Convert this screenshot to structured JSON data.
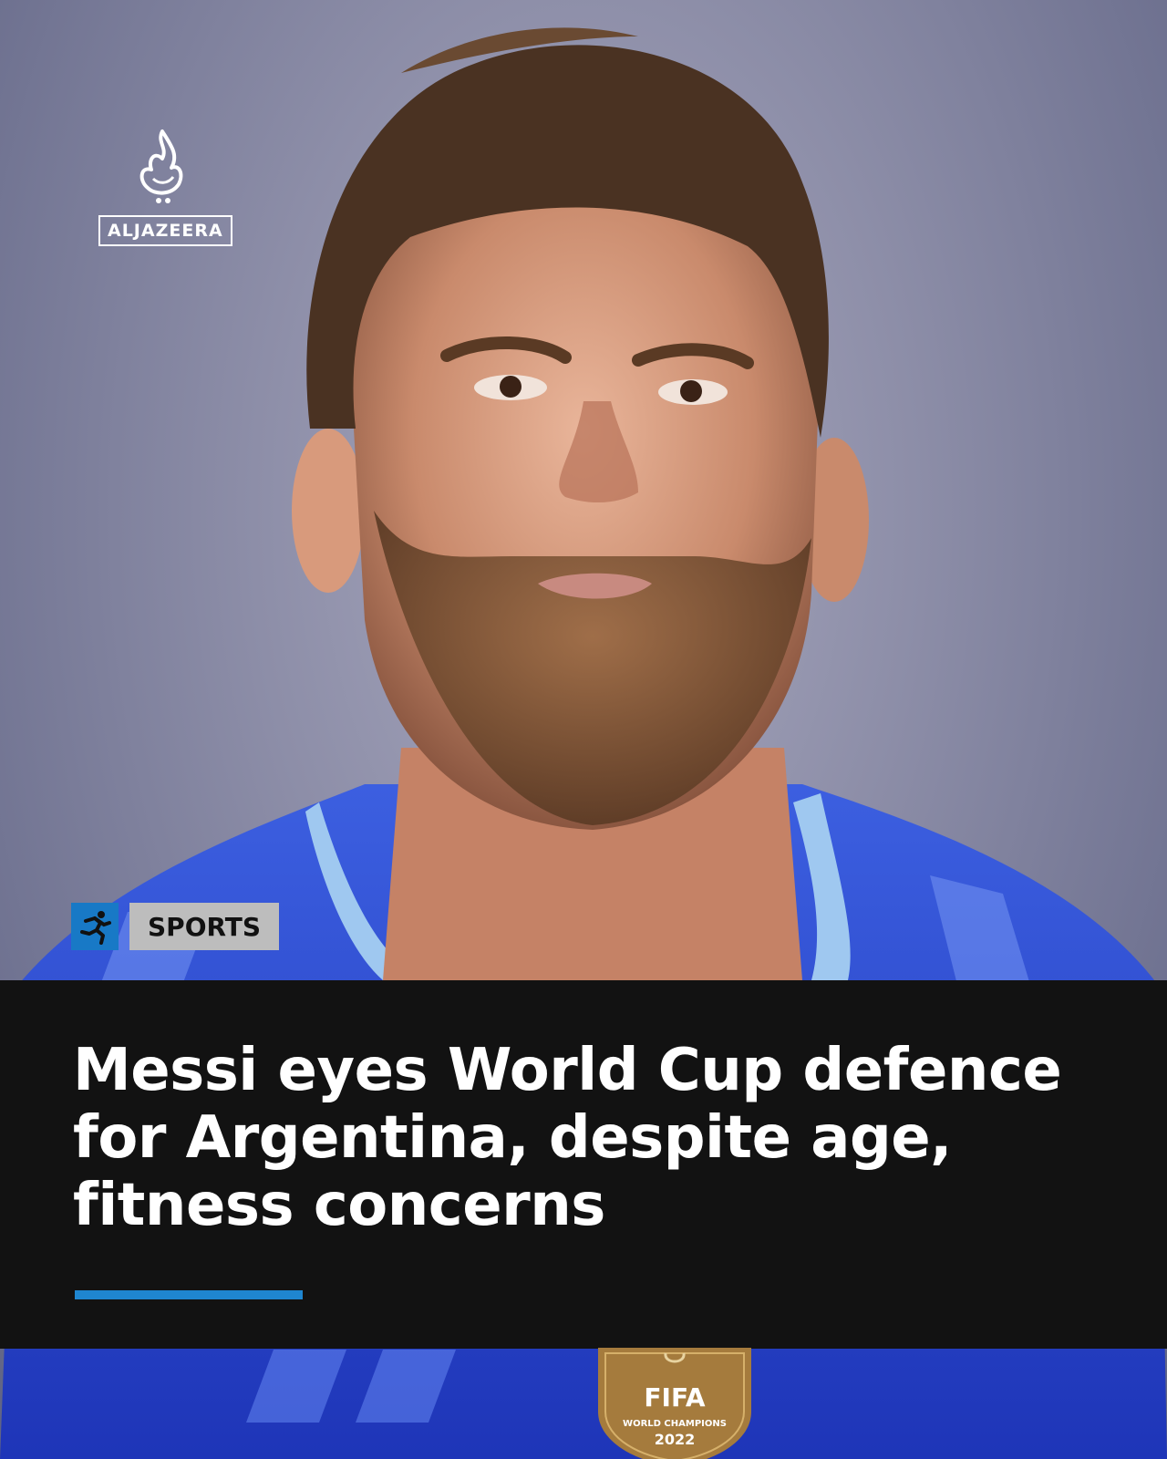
{
  "brand": {
    "name": "ALJAZEERA"
  },
  "category": {
    "label": "SPORTS",
    "icon": "runner-icon"
  },
  "headline": "Messi eyes World Cup defence for Argentina, despite age, fitness concerns",
  "badge": {
    "line1": "FIFA",
    "line2": "WORLD CHAMPIONS",
    "line3": "2022"
  },
  "colors": {
    "accent": "#1f86d0",
    "panel": "#121212",
    "tag_bg": "#bdbdbd",
    "icon_bg": "#1879c6",
    "jersey": "#2a44c9"
  }
}
